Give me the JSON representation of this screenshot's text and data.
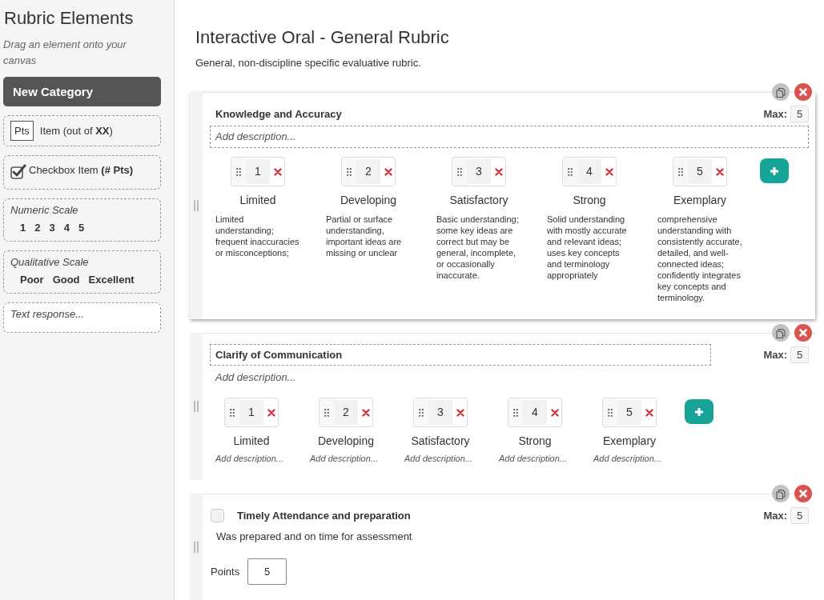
{
  "sidebar": {
    "title": "Rubric Elements",
    "hint": "Drag an element onto your canvas",
    "new_category_button": "New Category",
    "elements": [
      {
        "kind": "points_item",
        "badge": "Pts",
        "label": "Item (out of **XX**)"
      },
      {
        "kind": "checkbox_item",
        "checked": true,
        "label": "Checkbox Item **(# Pts)**"
      },
      {
        "kind": "scale",
        "label": "Numeric Scale",
        "values": [
          "1",
          "2",
          "3",
          "4",
          "5"
        ]
      },
      {
        "kind": "scale",
        "label": "Qualitative Scale",
        "values": [
          "Poor",
          "Good",
          "Excellent"
        ]
      },
      {
        "kind": "text_response",
        "placeholder": "Text response..."
      }
    ]
  },
  "rubric": {
    "title": "Interactive Oral - General Rubric",
    "description": "General, non-discipline specific evaluative rubric.",
    "categories": [
      {
        "kind": "scale",
        "selected": true,
        "title": {
          "text": "Knowledge and Accuracy",
          "outlined": false
        },
        "max_label": "Max:",
        "max": "5",
        "description": {
          "placeholder": "Add description...",
          "outlined": true
        },
        "levels": [
          {
            "score": "1",
            "name": "Limited",
            "description": "Limited understanding; frequent inaccuracies or misconceptions;"
          },
          {
            "score": "2",
            "name": "Developing",
            "description": "Partial or surface understanding, important ideas are missing or unclear"
          },
          {
            "score": "3",
            "name": "Satisfactory",
            "description": "Basic understanding; some key ideas are correct but may be general, incomplete, or occasionally inaccurate."
          },
          {
            "score": "4",
            "name": "Strong",
            "description": "Solid understanding with mostly accurate and relevant ideas; uses key concepts and terminology appropriately"
          },
          {
            "score": "5",
            "name": "Exemplary",
            "description": "comprehensive understanding with consistently accurate, detailed, and well-connected ideas; confidently integrates key concepts and terminology."
          }
        ]
      },
      {
        "kind": "scale",
        "selected": false,
        "title": {
          "text": "Clarify of Communication",
          "outlined": true
        },
        "max_label": "Max:",
        "max": "5",
        "description": {
          "placeholder": "Add description...",
          "outlined": false
        },
        "levels": [
          {
            "score": "1",
            "name": "Limited",
            "placeholder": "Add description..."
          },
          {
            "score": "2",
            "name": "Developing",
            "placeholder": "Add description..."
          },
          {
            "score": "3",
            "name": "Satisfactory",
            "placeholder": "Add description..."
          },
          {
            "score": "4",
            "name": "Strong",
            "placeholder": "Add description..."
          },
          {
            "score": "5",
            "name": "Exemplary",
            "placeholder": "Add description..."
          }
        ]
      },
      {
        "kind": "checkbox",
        "selected": false,
        "checked": false,
        "title": {
          "text": "Timely Attendance and preparation",
          "outlined": false
        },
        "max_label": "Max:",
        "max": "5",
        "description": {
          "text": "Was prepared and on time for assessment",
          "outlined": false
        },
        "points_label": "Points",
        "points": "5"
      }
    ]
  }
}
